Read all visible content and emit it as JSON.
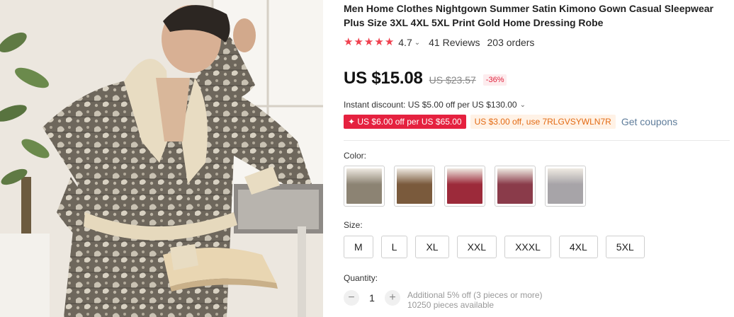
{
  "product": {
    "title": "Men Home Clothes Nightgown Summer Satin Kimono Gown Casual Sleepwear Plus Size 3XL 4XL 5XL Print Gold Home Dressing Robe",
    "rating": "4.7",
    "stars_filled": 5,
    "reviews": "41 Reviews",
    "orders": "203 orders"
  },
  "price": {
    "current": "US $15.08",
    "original": "US $23.57",
    "discount": "-36%"
  },
  "instant_discount": "Instant discount: US $5.00 off per US $130.00",
  "coupons": {
    "red": "✦ US $6.00 off per US $65.00",
    "orange": "US $3.00 off, use 7RLGVSYWLN7R",
    "link": "Get coupons"
  },
  "color": {
    "label": "Color:",
    "options": [
      {
        "name": "gray-paisley",
        "accent": "#8c8373"
      },
      {
        "name": "brown-paisley",
        "accent": "#7a5a3c"
      },
      {
        "name": "red-collar",
        "accent": "#9c2a3a"
      },
      {
        "name": "red-paisley",
        "accent": "#8a3b4a"
      },
      {
        "name": "light-gray",
        "accent": "#a7a4a8"
      }
    ]
  },
  "size": {
    "label": "Size:",
    "options": [
      "M",
      "L",
      "XL",
      "XXL",
      "XXXL",
      "4XL",
      "5XL"
    ]
  },
  "quantity": {
    "label": "Quantity:",
    "value": "1",
    "minus": "−",
    "plus": "+",
    "note": "Additional 5% off (3 pieces or more)",
    "available": "10250 pieces available"
  },
  "colors": {
    "accent_red": "#e5213f",
    "star": "#f0414f",
    "coupon_orange": "#e36a13",
    "link": "#5f7d9b"
  }
}
